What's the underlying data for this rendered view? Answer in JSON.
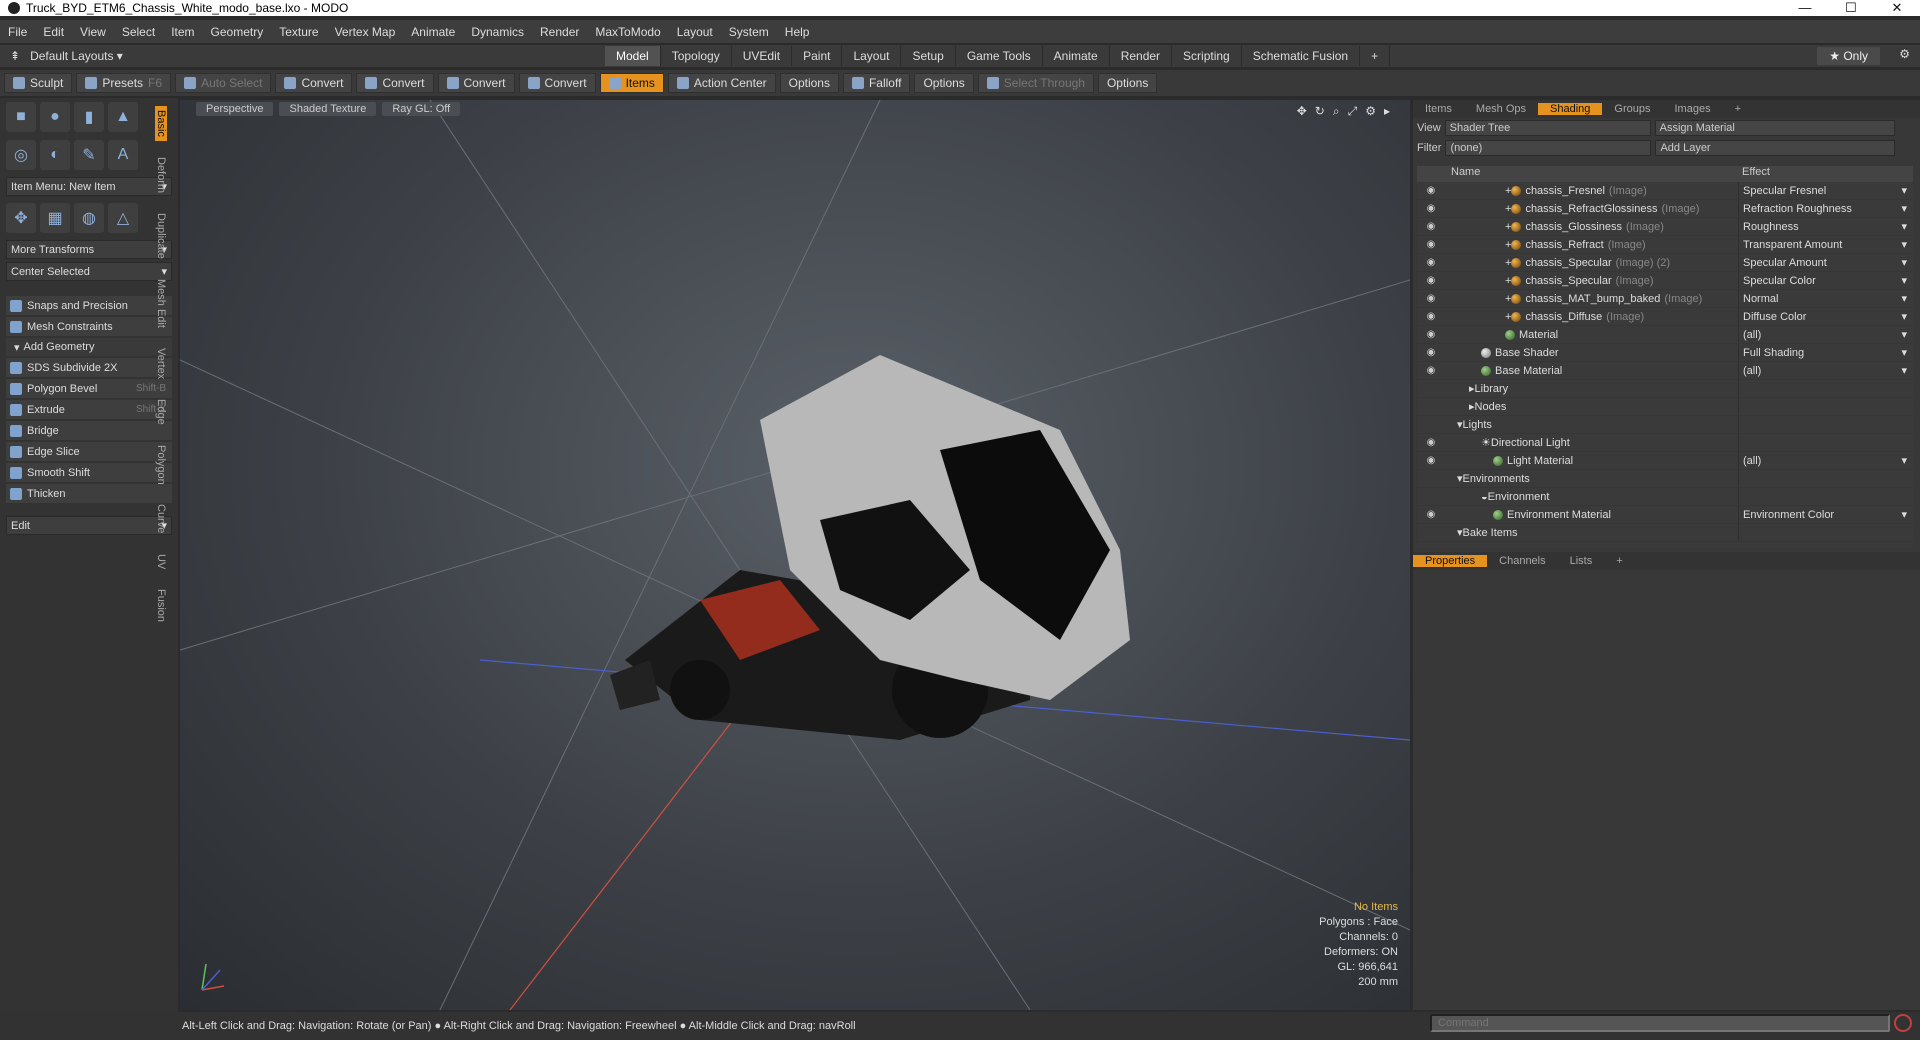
{
  "window": {
    "title": "Truck_BYD_ETM6_Chassis_White_modo_base.lxo - MODO",
    "min": "—",
    "max": "☐",
    "close": "✕"
  },
  "menu": [
    "File",
    "Edit",
    "View",
    "Select",
    "Item",
    "Geometry",
    "Texture",
    "Vertex Map",
    "Animate",
    "Dynamics",
    "Render",
    "MaxToModo",
    "Layout",
    "System",
    "Help"
  ],
  "layout_bar": {
    "default_layouts": "Default Layouts ▾",
    "tabs": [
      "Model",
      "Topology",
      "UVEdit",
      "Paint",
      "Layout",
      "Setup",
      "Game Tools",
      "Animate",
      "Render",
      "Scripting",
      "Schematic Fusion",
      "+"
    ],
    "active_tab": "Model",
    "only": "★ Only"
  },
  "toolbar": {
    "sculpt": "Sculpt",
    "presets": "Presets",
    "presets_key": "F6",
    "auto_select": "Auto Select",
    "convert1": "Convert",
    "convert2": "Convert",
    "convert3": "Convert",
    "convert4": "Convert",
    "items": "Items",
    "action_center": "Action Center",
    "options1": "Options",
    "falloff": "Falloff",
    "options2": "Options",
    "select_through": "Select Through",
    "options3": "Options"
  },
  "left": {
    "item_menu": "Item Menu: New Item",
    "more_transforms": "More Transforms",
    "center_selected": "Center Selected",
    "snaps": "Snaps and Precision",
    "mesh_constraints": "Mesh Constraints",
    "add_geometry": "Add Geometry",
    "tools": [
      {
        "label": "SDS Subdivide 2X",
        "key": ""
      },
      {
        "label": "Polygon Bevel",
        "key": "Shift-B"
      },
      {
        "label": "Extrude",
        "key": "Shift-X"
      },
      {
        "label": "Bridge",
        "key": ""
      },
      {
        "label": "Edge Slice",
        "key": ""
      },
      {
        "label": "Smooth Shift",
        "key": ""
      },
      {
        "label": "Thicken",
        "key": ""
      }
    ],
    "edit": "Edit",
    "vtabs": [
      "Basic",
      "Deform",
      "Duplicate",
      "Mesh Edit",
      "Vertex",
      "Edge",
      "Polygon",
      "Curve",
      "UV",
      "Fusion"
    ]
  },
  "viewport": {
    "perspective": "Perspective",
    "shading": "Shaded Texture",
    "raygl": "Ray GL: Off",
    "stats": {
      "no_items": "No Items",
      "polygons": "Polygons : Face",
      "channels": "Channels: 0",
      "deformers": "Deformers: ON",
      "gl": "GL: 966,641",
      "scale": "200 mm"
    }
  },
  "right": {
    "tabs": [
      "Items",
      "Mesh Ops",
      "Shading",
      "Groups",
      "Images",
      "+"
    ],
    "active_tab": "Shading",
    "view_label": "View",
    "view_value": "Shader Tree",
    "assign_material": "Assign Material",
    "filter_label": "Filter",
    "filter_value": "(none)",
    "add_layer": "Add Layer",
    "col_name": "Name",
    "col_effect": "Effect",
    "rows": [
      {
        "name": "chassis_Fresnel",
        "sub": "(Image)",
        "effect": "Specular Fresnel",
        "indent": 5,
        "type": "img",
        "eye": true
      },
      {
        "name": "chassis_RefractGlossiness",
        "sub": "(Image)",
        "effect": "Refraction Roughness",
        "indent": 5,
        "type": "img",
        "eye": true
      },
      {
        "name": "chassis_Glossiness",
        "sub": "(Image)",
        "effect": "Roughness",
        "indent": 5,
        "type": "img",
        "eye": true
      },
      {
        "name": "chassis_Refract",
        "sub": "(Image)",
        "effect": "Transparent Amount",
        "indent": 5,
        "type": "img",
        "eye": true
      },
      {
        "name": "chassis_Specular",
        "sub": "(Image) (2)",
        "effect": "Specular Amount",
        "indent": 5,
        "type": "img",
        "eye": true
      },
      {
        "name": "chassis_Specular",
        "sub": "(Image)",
        "effect": "Specular Color",
        "indent": 5,
        "type": "img",
        "eye": true
      },
      {
        "name": "chassis_MAT_bump_baked",
        "sub": "(Image)",
        "effect": "Normal",
        "indent": 5,
        "type": "img",
        "eye": true
      },
      {
        "name": "chassis_Diffuse",
        "sub": "(Image)",
        "effect": "Diffuse Color",
        "indent": 5,
        "type": "img",
        "eye": true
      },
      {
        "name": "Material",
        "sub": "",
        "effect": "(all)",
        "indent": 5,
        "type": "mat",
        "eye": true
      },
      {
        "name": "Base Shader",
        "sub": "",
        "effect": "Full Shading",
        "indent": 3,
        "type": "shader",
        "eye": true
      },
      {
        "name": "Base Material",
        "sub": "",
        "effect": "(all)",
        "indent": 3,
        "type": "mat",
        "eye": true
      },
      {
        "name": "Library",
        "sub": "",
        "effect": "",
        "indent": 2,
        "type": "folder",
        "eye": false
      },
      {
        "name": "Nodes",
        "sub": "",
        "effect": "",
        "indent": 2,
        "type": "folder",
        "eye": false
      },
      {
        "name": "Lights",
        "sub": "",
        "effect": "",
        "indent": 1,
        "type": "group",
        "eye": false
      },
      {
        "name": "Directional Light",
        "sub": "",
        "effect": "",
        "indent": 3,
        "type": "light",
        "eye": true
      },
      {
        "name": "Light Material",
        "sub": "",
        "effect": "(all)",
        "indent": 4,
        "type": "mat",
        "eye": true
      },
      {
        "name": "Environments",
        "sub": "",
        "effect": "",
        "indent": 1,
        "type": "group",
        "eye": false
      },
      {
        "name": "Environment",
        "sub": "",
        "effect": "",
        "indent": 3,
        "type": "env",
        "eye": false
      },
      {
        "name": "Environment Material",
        "sub": "",
        "effect": "Environment Color",
        "indent": 4,
        "type": "mat",
        "eye": true
      },
      {
        "name": "Bake Items",
        "sub": "",
        "effect": "",
        "indent": 1,
        "type": "group",
        "eye": false
      }
    ],
    "props_tabs": [
      "Properties",
      "Channels",
      "Lists",
      "+"
    ],
    "props_active": "Properties"
  },
  "statusbar": {
    "hint": "Alt-Left Click and Drag: Navigation: Rotate (or Pan) ● Alt-Right Click and Drag: Navigation: Freewheel ● Alt-Middle Click and Drag: navRoll",
    "command_placeholder": "Command"
  },
  "colors": {
    "accent": "#e6921f",
    "panel": "#383838",
    "viewport": "#4a4f55"
  }
}
